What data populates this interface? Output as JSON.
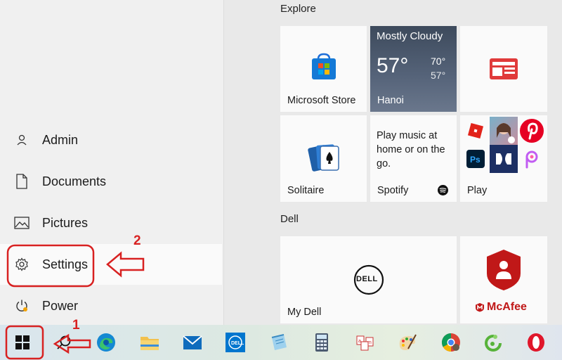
{
  "start_menu": {
    "left_pane": {
      "items": [
        {
          "label": "Admin",
          "icon": "person-icon"
        },
        {
          "label": "Documents",
          "icon": "document-icon"
        },
        {
          "label": "Pictures",
          "icon": "pictures-icon"
        },
        {
          "label": "Settings",
          "icon": "gear-icon",
          "selected": true
        },
        {
          "label": "Power",
          "icon": "power-icon"
        }
      ]
    },
    "groups": [
      {
        "title": "Explore"
      },
      {
        "title": "Dell"
      }
    ],
    "tiles": {
      "microsoft_store": {
        "label": "Microsoft Store"
      },
      "weather": {
        "condition": "Mostly Cloudy",
        "temp": "57°",
        "high": "70°",
        "low": "57°",
        "location": "Hanoi"
      },
      "news": {
        "label": ""
      },
      "solitaire": {
        "label": "Solitaire"
      },
      "spotify": {
        "text": "Play music at home or on the go.",
        "label": "Spotify"
      },
      "play": {
        "label": "Play"
      },
      "my_dell": {
        "label": "My Dell",
        "logo": "DELL"
      },
      "mcafee": {
        "label": "McAfee"
      }
    }
  },
  "taskbar": {
    "icons": [
      "windows-start-icon",
      "search-icon",
      "edge-icon",
      "file-explorer-icon",
      "mail-icon",
      "dell-icon",
      "notepad-icon",
      "calculator-icon",
      "language-icon",
      "paint-icon",
      "chrome-icon",
      "green-app-icon",
      "opera-icon"
    ]
  },
  "annotations": {
    "step1": "1",
    "step2": "2"
  },
  "colors": {
    "annotation_red": "#d82121",
    "accent_blue": "#0078d4",
    "mcafee_red": "#c01818"
  }
}
